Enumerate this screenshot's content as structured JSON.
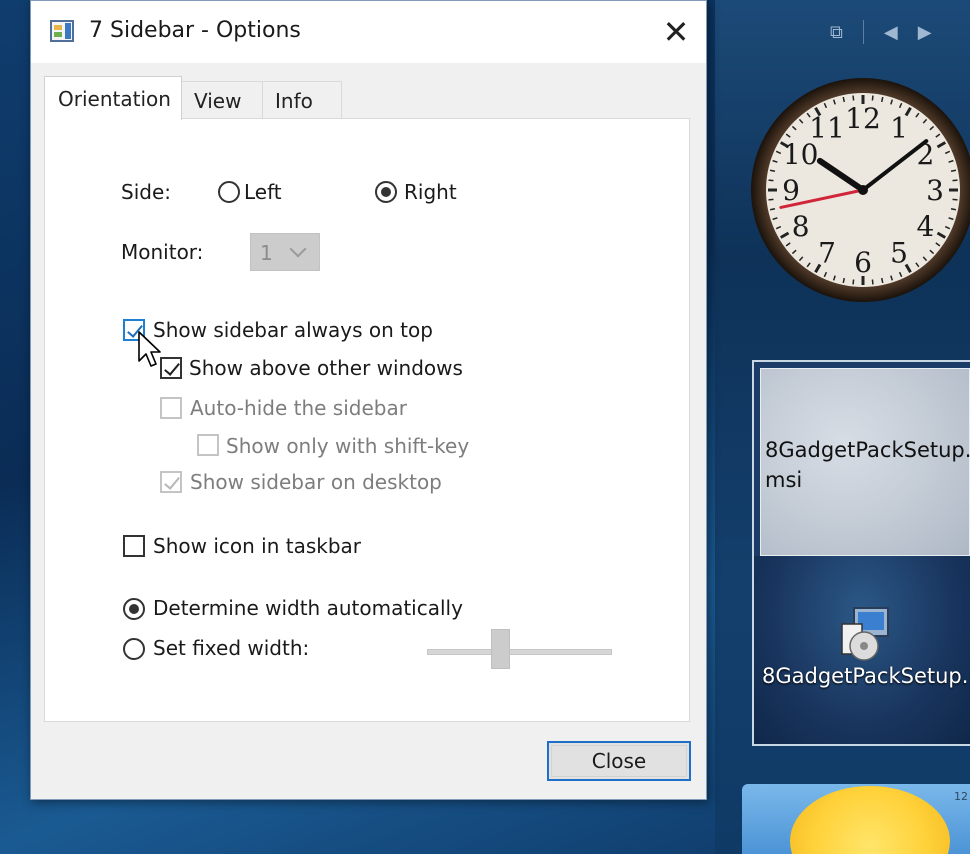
{
  "dialog": {
    "title": "7 Sidebar - Options",
    "close_glyph": "✕",
    "tabs": [
      {
        "label": "Orientation",
        "active": true
      },
      {
        "label": "View",
        "active": false
      },
      {
        "label": "Info",
        "active": false
      }
    ],
    "side": {
      "label": "Side:",
      "options": [
        {
          "label": "Left",
          "checked": false
        },
        {
          "label": "Right",
          "checked": true
        }
      ]
    },
    "monitor": {
      "label": "Monitor:",
      "value": "1",
      "enabled": false
    },
    "checkboxes": {
      "always_on_top": {
        "label": "Show sidebar always on top",
        "checked": true,
        "enabled": true
      },
      "above_other_windows": {
        "label": "Show above other windows",
        "checked": true,
        "enabled": true
      },
      "auto_hide": {
        "label": "Auto-hide the sidebar",
        "checked": false,
        "enabled": false
      },
      "shift_key": {
        "label": "Show only with shift-key",
        "checked": false,
        "enabled": false
      },
      "on_desktop": {
        "label": "Show sidebar on desktop",
        "checked": true,
        "enabled": false
      },
      "taskbar_icon": {
        "label": "Show icon in taskbar",
        "checked": false,
        "enabled": true
      }
    },
    "width": {
      "options": [
        {
          "label": "Determine width automatically",
          "checked": true
        },
        {
          "label": "Set fixed width:",
          "checked": false
        }
      ],
      "slider_enabled": false
    },
    "close_button": "Close"
  },
  "desktop": {
    "sidebar_icons": [
      "window-icon",
      "prev-arrow-icon",
      "next-arrow-icon"
    ],
    "clock": {
      "numerals": [
        "12",
        "1",
        "2",
        "3",
        "4",
        "5",
        "6",
        "7",
        "8",
        "9",
        "10",
        "11"
      ],
      "hour": 10,
      "minute": 8,
      "second": 43
    },
    "file_tile": {
      "top_label": "8GadgetPackSetup.\nmsi",
      "bottom_label": "8GadgetPackSetup..."
    },
    "weather_text": "12"
  },
  "colors": {
    "accent": "#1d6fc7",
    "second_hand": "#d1253a",
    "dialog_bg": "#f0f0f0"
  }
}
